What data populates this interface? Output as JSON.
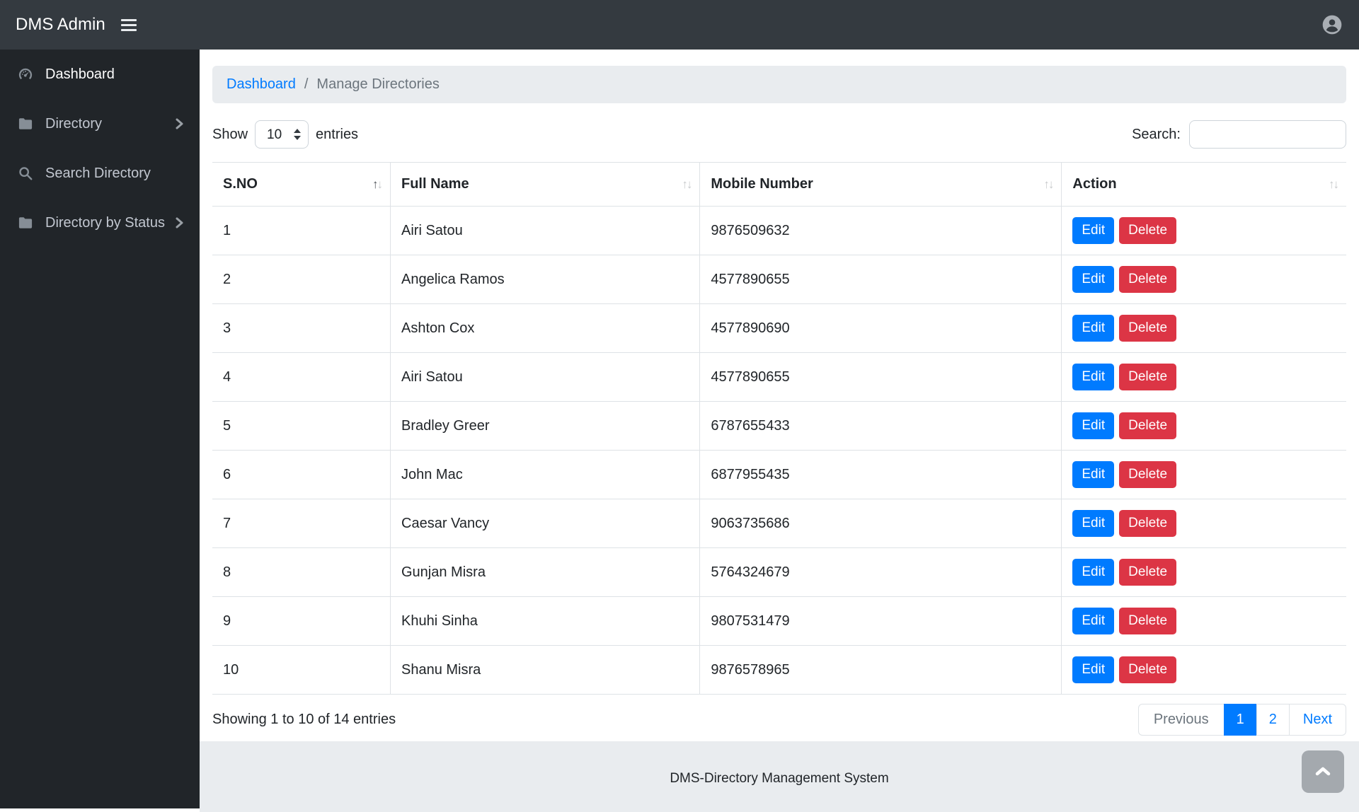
{
  "navbar": {
    "brand": "DMS Admin",
    "icons": [
      "menu-icon",
      "user-circle-icon"
    ]
  },
  "sidebar": {
    "items": [
      {
        "label": "Dashboard",
        "icon": "dashboard-icon",
        "active": true,
        "chevron": false
      },
      {
        "label": "Directory",
        "icon": "folder-icon",
        "active": false,
        "chevron": true
      },
      {
        "label": "Search Directory",
        "icon": "search-icon",
        "active": false,
        "chevron": false
      },
      {
        "label": "Directory by Status",
        "icon": "folder-icon",
        "active": false,
        "chevron": true
      }
    ]
  },
  "breadcrumb": {
    "link": "Dashboard",
    "separator": "/",
    "current": "Manage Directories"
  },
  "controls": {
    "show_label": "Show",
    "page_size": "10",
    "entries_label": "entries",
    "search_label": "Search:",
    "search_value": ""
  },
  "table": {
    "headers": [
      {
        "label": "S.NO",
        "sorted": "asc"
      },
      {
        "label": "Full Name",
        "sorted": null
      },
      {
        "label": "Mobile Number",
        "sorted": null
      },
      {
        "label": "Action",
        "sorted": null
      }
    ],
    "col_widths": [
      "15.7%",
      "27.3%",
      "31.9%",
      "25.1%"
    ],
    "rows": [
      {
        "sno": "1",
        "name": "Airi Satou",
        "mobile": "9876509632"
      },
      {
        "sno": "2",
        "name": "Angelica Ramos",
        "mobile": "4577890655"
      },
      {
        "sno": "3",
        "name": "Ashton Cox",
        "mobile": "4577890690"
      },
      {
        "sno": "4",
        "name": "Airi Satou",
        "mobile": "4577890655"
      },
      {
        "sno": "5",
        "name": "Bradley Greer",
        "mobile": "6787655433"
      },
      {
        "sno": "6",
        "name": "John Mac",
        "mobile": "6877955435"
      },
      {
        "sno": "7",
        "name": "Caesar Vancy",
        "mobile": "9063735686"
      },
      {
        "sno": "8",
        "name": "Gunjan Misra",
        "mobile": "5764324679"
      },
      {
        "sno": "9",
        "name": "Khuhi Sinha",
        "mobile": "9807531479"
      },
      {
        "sno": "10",
        "name": "Shanu Misra",
        "mobile": "9876578965"
      }
    ],
    "edit_label": "Edit",
    "delete_label": "Delete"
  },
  "table_footer": {
    "showing": "Showing 1 to 10 of 14 entries",
    "pagination": [
      {
        "label": "Previous",
        "state": "disabled"
      },
      {
        "label": "1",
        "state": "active"
      },
      {
        "label": "2",
        "state": "link"
      },
      {
        "label": "Next",
        "state": "link"
      }
    ]
  },
  "footer": {
    "text": "DMS-Directory Management System",
    "scroll_top_icon": "chevron-up-icon"
  },
  "colors": {
    "primary": "#007bff",
    "danger": "#dc3545",
    "navbar_bg": "#343a40",
    "sidebar_bg": "#212529",
    "breadcrumb_bg": "#e9ecef",
    "footer_bg": "#e9ecef"
  }
}
